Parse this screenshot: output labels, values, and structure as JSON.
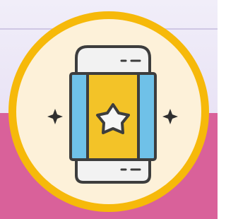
{
  "scene": {
    "badge_icon": "eraser-with-star-icon",
    "left_sparkle_icon": "sparkle-icon",
    "right_sparkle_icon": "sparkle-icon",
    "colors": {
      "background_top": "#ece7f7",
      "background_bottom": "#d9619a",
      "badge_outer_ring": "#f6b90a",
      "badge_fill": "#fdf1d9",
      "eraser_sleeve": "#f3c328",
      "eraser_band": "#6fc1e8",
      "eraser_caps": "#f2f2f2",
      "star": "#f6f6f6",
      "outline": "#3d3d3d"
    }
  }
}
